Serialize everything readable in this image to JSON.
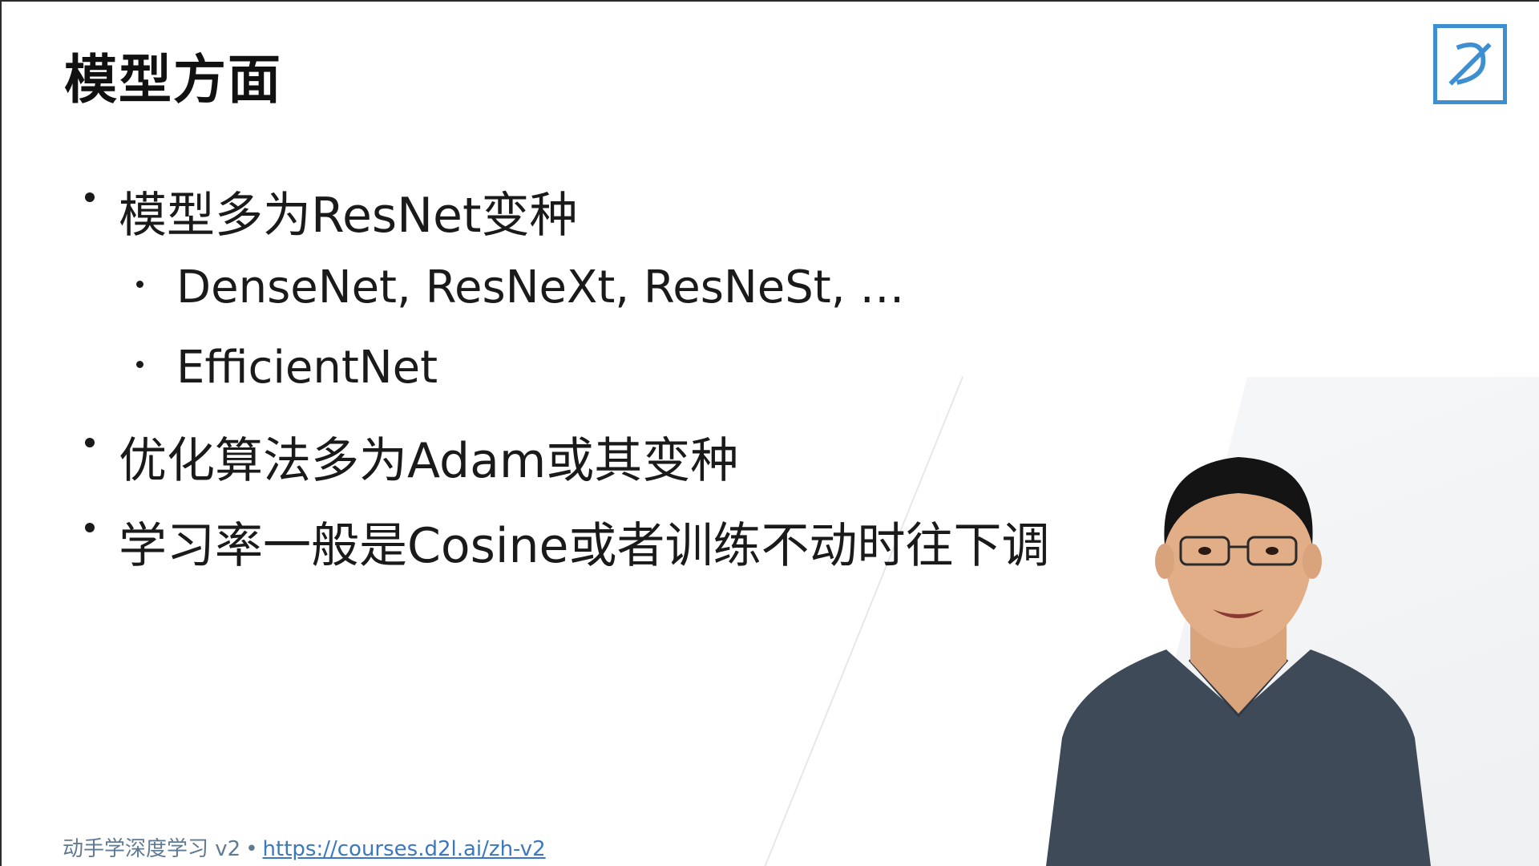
{
  "slide": {
    "title": "模型方面",
    "bullets": [
      {
        "level": 1,
        "text": "模型多为ResNet变种"
      },
      {
        "level": 2,
        "text": "DenseNet, ResNeXt, ResNeSt, …"
      },
      {
        "level": 2,
        "text": "EfficientNet"
      },
      {
        "level": 1,
        "text": "优化算法多为Adam或其变种"
      },
      {
        "level": 1,
        "text": "学习率一般是Cosine或者训练不动时往下调"
      }
    ]
  },
  "footer": {
    "course": "动手学深度学习 v2",
    "separator": "•",
    "link": "https://courses.d2l.ai/zh-v2"
  },
  "watermark": {
    "logo_icon": "d2l-logo-icon",
    "accent_color": "#3d8fd0"
  },
  "colors": {
    "footer_text": "#5f7a93",
    "link": "#3a78c2"
  }
}
